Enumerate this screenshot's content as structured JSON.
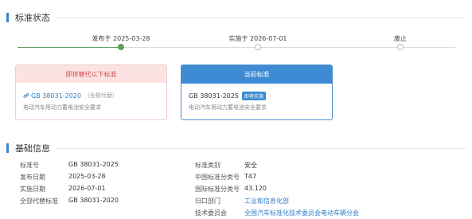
{
  "status_section": {
    "title": "标准状态"
  },
  "timeline": {
    "steps": [
      {
        "label": "发布于 2025-03-28",
        "done": true
      },
      {
        "label": "实施于 2026-07-01",
        "done": false
      },
      {
        "label": "废止",
        "done": false
      }
    ]
  },
  "replaced_card": {
    "header": "即将替代以下标准",
    "code": "GB 38031-2020",
    "note": "（全部代替）",
    "desc": "电动汽车用动力蓄电池安全要求"
  },
  "current_card": {
    "header": "当前标准",
    "code": "GB 38031-2025",
    "badge": "即将实施",
    "desc": "电动汽车用动力蓄电池安全要求"
  },
  "basic_section": {
    "title": "基础信息"
  },
  "basic_info": {
    "left": [
      {
        "label": "标准号",
        "value": "GB 38031-2025"
      },
      {
        "label": "发布日期",
        "value": "2025-03-28"
      },
      {
        "label": "实施日期",
        "value": "2026-07-01"
      },
      {
        "label": "全部代替标准",
        "value": "GB 38031-2020"
      }
    ],
    "right": [
      {
        "label": "标准类别",
        "value": "安全"
      },
      {
        "label": "中国标准分类号",
        "value": "T47"
      },
      {
        "label": "国际标准分类号",
        "value": "43.120"
      },
      {
        "label": "归口部门",
        "value": "工业和信息化部"
      },
      {
        "label": "技术委员会",
        "value": "全国汽车标准化技术委员会电动车辆分会"
      }
    ]
  },
  "colors": {
    "accent": "#3e8bd3",
    "done": "#5aa05a",
    "danger": "#d24b4b",
    "danger_bg": "#fbe3e3"
  }
}
